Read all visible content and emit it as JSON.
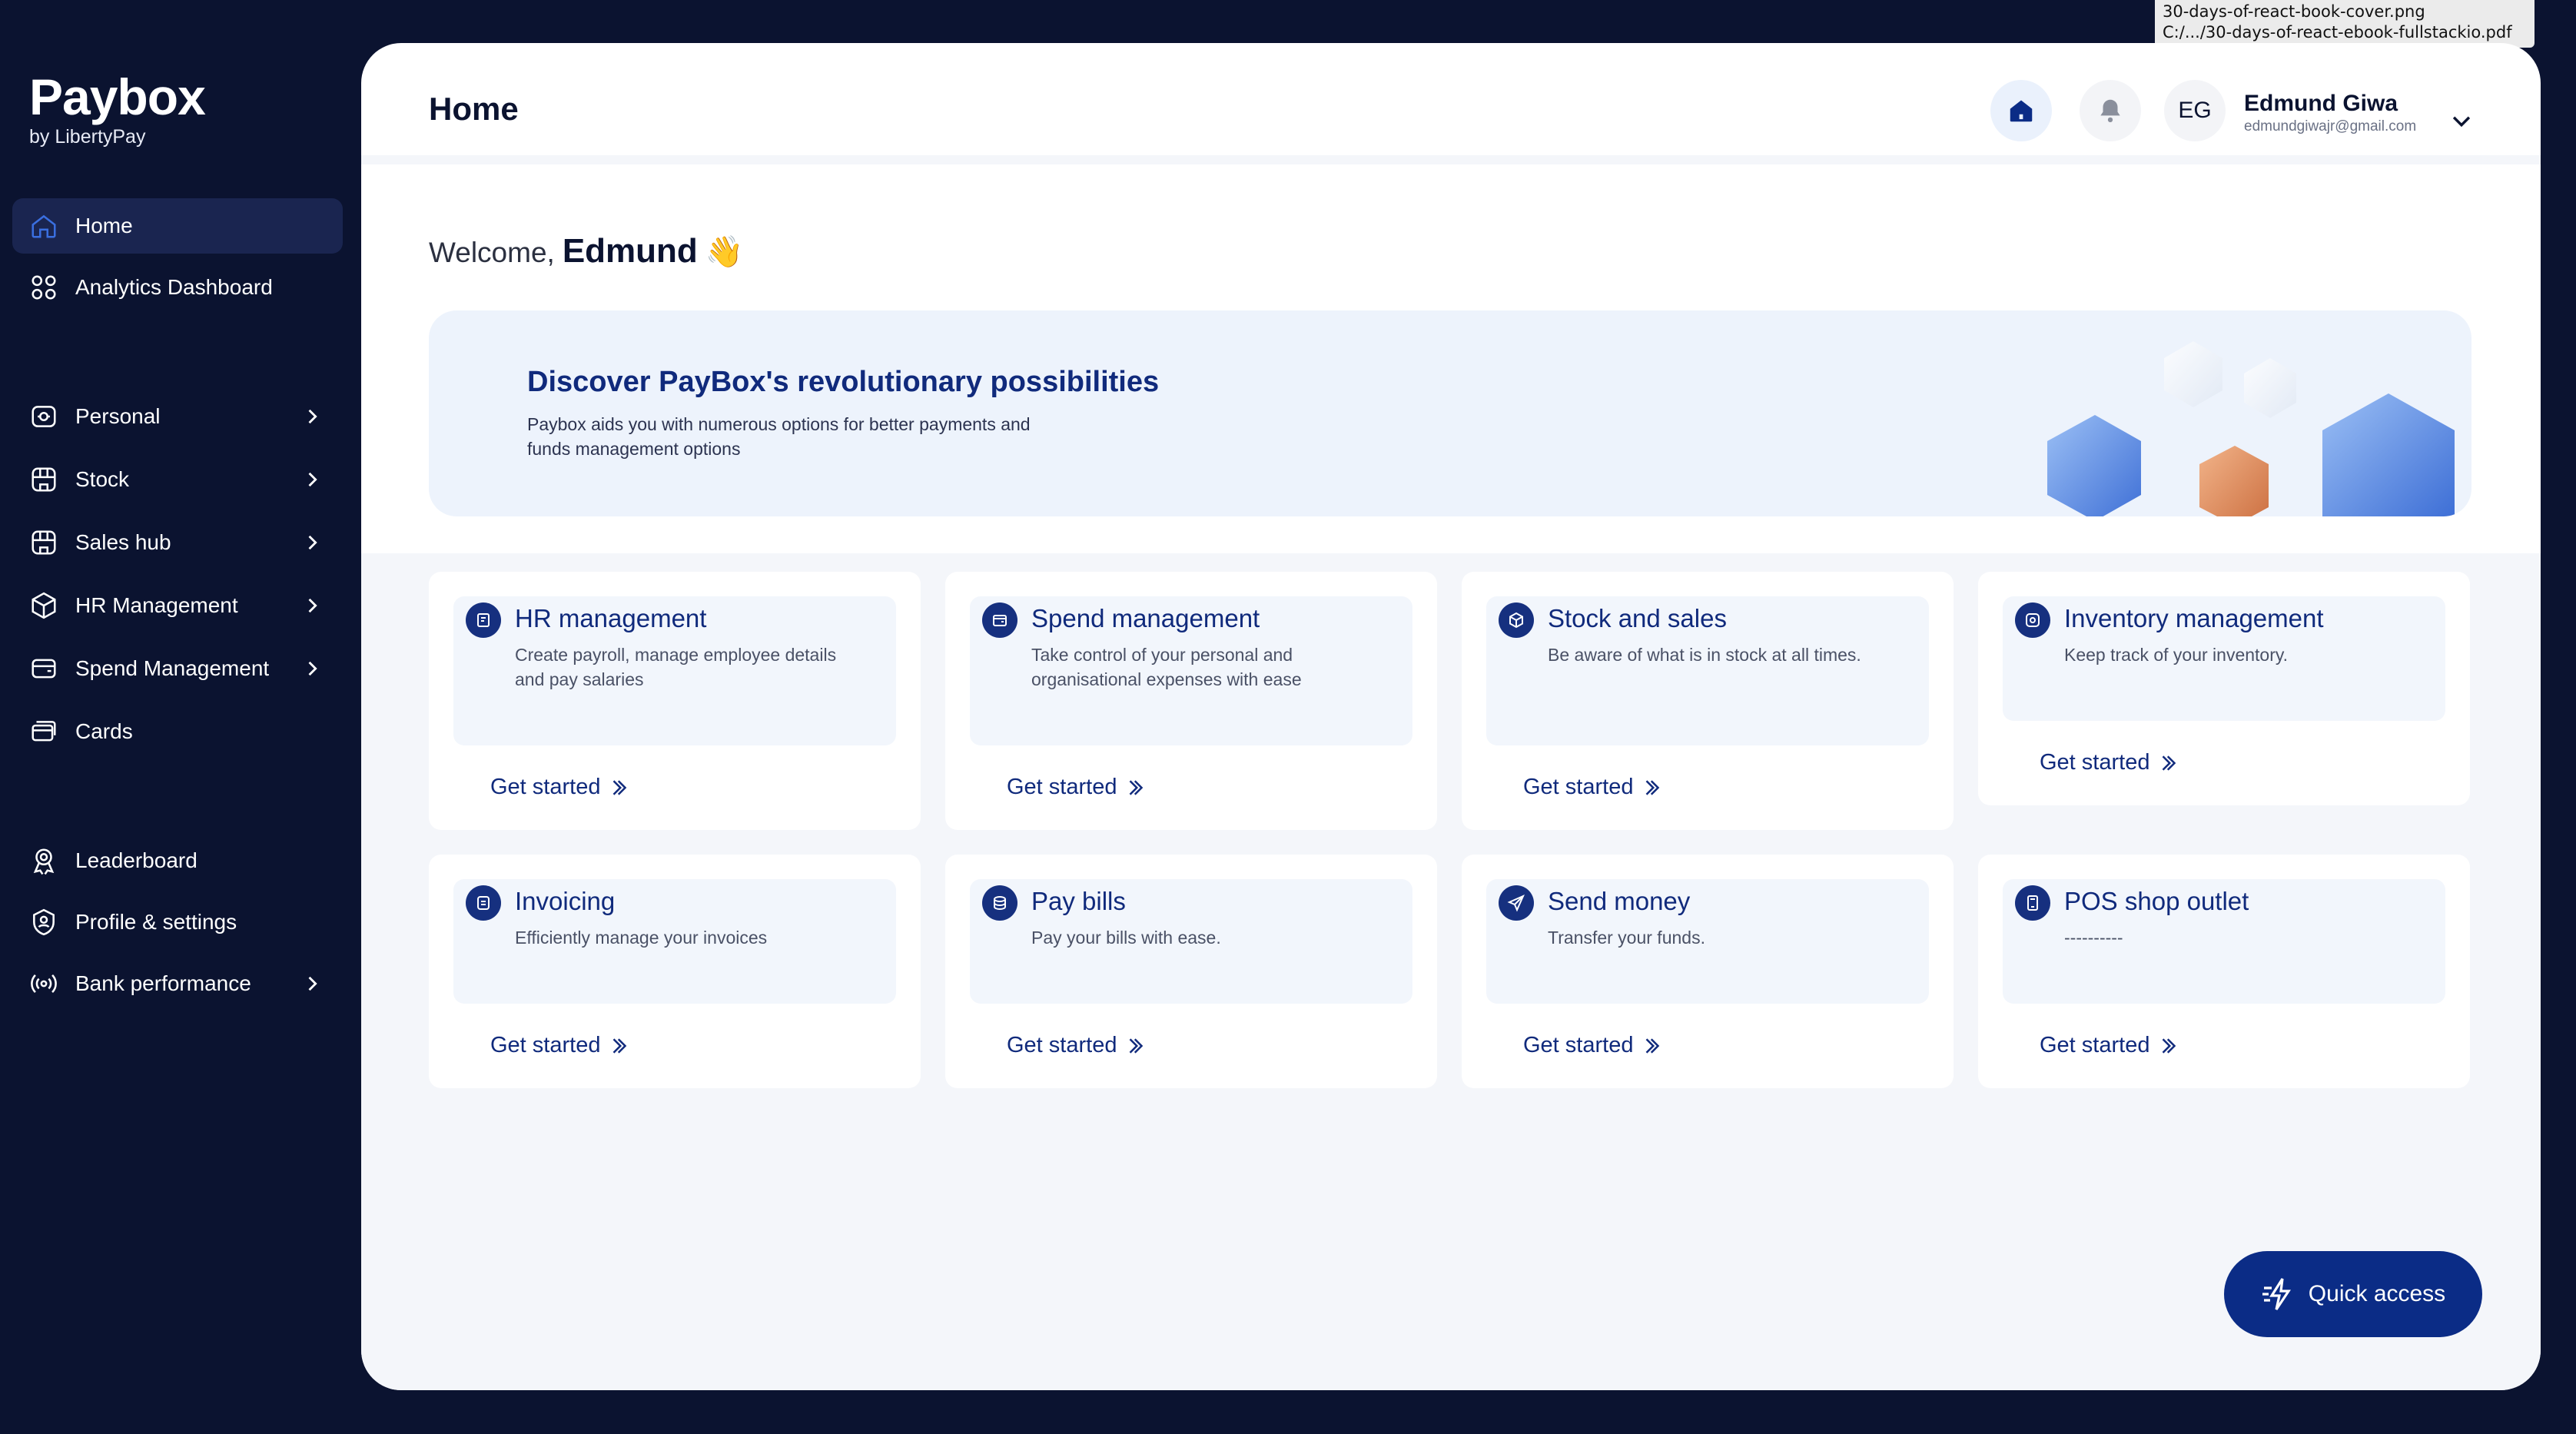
{
  "tooltip": {
    "line1": "30-days-of-react-book-cover.png",
    "line2": "C:/.../30-days-of-react-ebook-fullstackio.pdf"
  },
  "brand": {
    "name": "Paybox",
    "sub": "by LibertyPay"
  },
  "sidebar": {
    "items": [
      {
        "label": "Home",
        "icon": "home-icon",
        "active": true
      },
      {
        "label": "Analytics Dashboard",
        "icon": "grid-circles-icon"
      },
      {
        "label": "Personal",
        "icon": "wallet-icon",
        "chevron": true
      },
      {
        "label": "Stock",
        "icon": "store-icon",
        "chevron": true
      },
      {
        "label": "Sales hub",
        "icon": "store-icon",
        "chevron": true
      },
      {
        "label": "HR Management",
        "icon": "box-icon",
        "chevron": true
      },
      {
        "label": "Spend Management",
        "icon": "card-wallet-icon",
        "chevron": true
      },
      {
        "label": "Cards",
        "icon": "cards-icon"
      },
      {
        "label": "Leaderboard",
        "icon": "award-icon"
      },
      {
        "label": "Profile & settings",
        "icon": "profile-badge-icon"
      },
      {
        "label": "Bank performance",
        "icon": "broadcast-icon",
        "chevron": true
      }
    ]
  },
  "header": {
    "title": "Home",
    "avatar_initials": "EG",
    "user_name": "Edmund Giwa",
    "user_email": "edmundgiwajr@gmail.com"
  },
  "welcome": {
    "prefix": "Welcome,",
    "name": "Edmund",
    "emoji": "👋"
  },
  "banner": {
    "title": "Discover PayBox's revolutionary possibilities",
    "text": "Paybox aids you with numerous options for better payments and funds management options"
  },
  "cards": [
    {
      "title": "HR management",
      "desc": "Create payroll, manage employee details and pay salaries",
      "cta": "Get started"
    },
    {
      "title": "Spend management",
      "desc": "Take control of your personal and organisational expenses with ease",
      "cta": "Get started"
    },
    {
      "title": "Stock and sales",
      "desc": "Be aware of what is in stock at all times.",
      "cta": "Get started"
    },
    {
      "title": "Inventory management",
      "desc": "Keep track of your inventory.",
      "cta": "Get started"
    },
    {
      "title": "Invoicing",
      "desc": "Efficiently manage your invoices",
      "cta": "Get started"
    },
    {
      "title": "Pay bills",
      "desc": "Pay your bills with ease.",
      "cta": "Get started"
    },
    {
      "title": "Send money",
      "desc": "Transfer your funds.",
      "cta": "Get started"
    },
    {
      "title": "POS shop outlet",
      "desc": "----------",
      "cta": "Get started"
    }
  ],
  "quick_access": {
    "label": "Quick access"
  },
  "colors": {
    "sidebar_bg": "#0b1330",
    "accent": "#102a7c",
    "banner_bg": "#edf3fc",
    "quick_btn": "#0b2c86"
  }
}
